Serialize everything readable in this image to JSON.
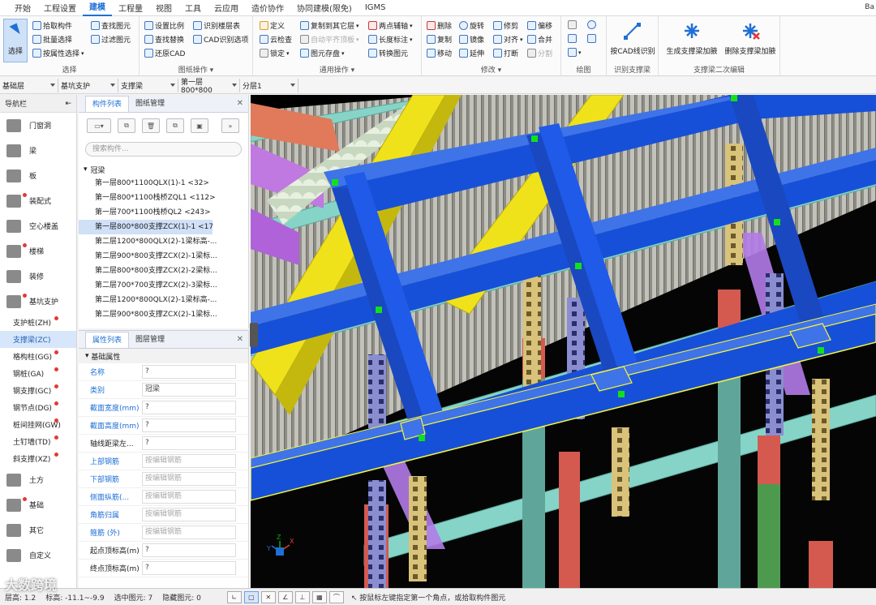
{
  "menu": {
    "items": [
      "开始",
      "工程设置",
      "建模",
      "工程量",
      "视图",
      "工具",
      "云应用",
      "造价协作",
      "协同建模(限免)",
      "IGMS"
    ],
    "active": "建模",
    "right_text": "Ba"
  },
  "ribbon": {
    "select_group": {
      "big_button": "选择",
      "pick": "拾取构件",
      "batch": "批量选择",
      "by_attr": "按属性选择",
      "find": "查找图元",
      "filter": "过滤图元",
      "label": "选择"
    },
    "drawing_group": {
      "scale": "设置比例",
      "find_replace": "查找替换",
      "restore_cad": "还原CAD",
      "identify_floor": "识别楼层表",
      "cad_options": "CAD识别选项",
      "label": "图纸操作"
    },
    "general_group": {
      "define": "定义",
      "cloud_check": "云检查",
      "lock": "锁定",
      "copy_floor": "复制到其它层",
      "auto_align": "自动平齐顶板",
      "save_element": "图元存盘",
      "two_point_axis": "两点辅轴",
      "length_mark": "长度标注",
      "convert": "转换图元",
      "label": "通用操作"
    },
    "modify_group": {
      "delete": "删除",
      "copy": "复制",
      "move": "移动",
      "rotate": "旋转",
      "mirror": "镜像",
      "extend": "延伸",
      "trim": "修剪",
      "align": "对齐",
      "break": "打断",
      "offset": "偏移",
      "merge": "合并",
      "split": "分割",
      "label": "修改"
    },
    "draw_group": {
      "label": "绘图"
    },
    "identify_group": {
      "button": "按CAD线识别",
      "label": "识别支撑梁"
    },
    "edit_group": {
      "generate": "生成支撑梁加腋",
      "remove": "删除支撑梁加腋",
      "label": "支撑梁二次编辑"
    }
  },
  "selectors": [
    "基础层",
    "基坑支护",
    "支撑梁",
    "第一层800*800",
    "分层1"
  ],
  "nav": {
    "title": "导航栏",
    "items": [
      {
        "label": "门窗洞",
        "dot": false
      },
      {
        "label": "梁",
        "dot": false
      },
      {
        "label": "板",
        "dot": false
      },
      {
        "label": "装配式",
        "dot": true
      },
      {
        "label": "空心楼盖",
        "dot": false
      },
      {
        "label": "楼梯",
        "dot": true
      },
      {
        "label": "装修",
        "dot": false
      },
      {
        "label": "基坑支护",
        "dot": true
      }
    ],
    "subitems": [
      {
        "label": "支护桩(ZH)",
        "dot": true,
        "selected": false
      },
      {
        "label": "支撑梁(ZC)",
        "dot": false,
        "selected": true
      },
      {
        "label": "格构柱(GG)",
        "dot": true,
        "selected": false
      },
      {
        "label": "钢桩(GA)",
        "dot": true,
        "selected": false
      },
      {
        "label": "钢支撑(GC)",
        "dot": true,
        "selected": false
      },
      {
        "label": "钢节点(DG)",
        "dot": true,
        "selected": false
      },
      {
        "label": "桩间挂网(GW)",
        "dot": true,
        "selected": false
      },
      {
        "label": "土钉墙(TD)",
        "dot": true,
        "selected": false
      },
      {
        "label": "斜支撑(XZ)",
        "dot": true,
        "selected": false
      }
    ],
    "bottom": [
      {
        "label": "土方",
        "dot": false
      },
      {
        "label": "基础",
        "dot": true
      },
      {
        "label": "其它",
        "dot": false
      },
      {
        "label": "自定义",
        "dot": false
      }
    ]
  },
  "components": {
    "tabs": [
      "构件列表",
      "图纸管理"
    ],
    "search_placeholder": "搜索构件...",
    "root": "冠梁",
    "rows": [
      "第一层800*1100QLX(1)-1 <32>",
      "第一层800*1100栈桥ZQL1 <112>",
      "第一层700*1100栈桥QL2 <243>",
      "第一层800*800支撑ZCX(1)-1 <17...",
      "第二层1200*800QLX(2)-1梁标高-...",
      "第二层900*800支撑ZCX(2)-1梁标...",
      "第二层800*800支撑ZCX(2)-2梁标...",
      "第二层700*700支撑ZCX(2)-3梁标...",
      "第二层1200*800QLX(2)-1梁标高-...",
      "第二层900*800支撑ZCX(2)-1梁标..."
    ],
    "selected_index": 3
  },
  "properties": {
    "tabs": [
      "属性列表",
      "图层管理"
    ],
    "group": "基础属性",
    "rows": [
      {
        "name": "名称",
        "value": "?",
        "placeholder": false,
        "blue": true
      },
      {
        "name": "类别",
        "value": "冠梁",
        "placeholder": false,
        "blue": true
      },
      {
        "name": "截面宽度(mm)",
        "value": "?",
        "placeholder": false,
        "blue": true
      },
      {
        "name": "截面高度(mm)",
        "value": "?",
        "placeholder": false,
        "blue": true
      },
      {
        "name": "轴线距梁左...",
        "value": "?",
        "placeholder": false,
        "blue": false
      },
      {
        "name": "上部钢筋",
        "value": "按编辑钢筋",
        "placeholder": true,
        "blue": true
      },
      {
        "name": "下部钢筋",
        "value": "按编辑钢筋",
        "placeholder": true,
        "blue": true
      },
      {
        "name": "侧面纵筋(...",
        "value": "按编辑钢筋",
        "placeholder": true,
        "blue": true
      },
      {
        "name": "角筋归属",
        "value": "按编辑钢筋",
        "placeholder": true,
        "blue": true
      },
      {
        "name": "箍筋 (外)",
        "value": "按编辑钢筋",
        "placeholder": true,
        "blue": true
      },
      {
        "name": "起点顶标高(m)",
        "value": "?",
        "placeholder": false,
        "blue": false
      },
      {
        "name": "终点顶标高(m)",
        "value": "?",
        "placeholder": false,
        "blue": false
      }
    ]
  },
  "status": {
    "floor_height_label": "层高:",
    "floor_height": "1.2",
    "elevation_label": "标高:",
    "elevation": "-11.1~-9.9",
    "selected_label": "选中图元:",
    "selected": "7",
    "hidden_label": "隐藏图元:",
    "hidden": "0",
    "hint": "按鼠标左键指定第一个角点，或拾取构件图元",
    "watermark": "大数跨境"
  },
  "colors": {
    "beam_blue": "#1750d8",
    "beam_yellow": "#f0e21a",
    "pile_gray": "#b0b0a8",
    "highlight": "#f5f53a",
    "marker": "#12e01a",
    "accent": "#1f6fd6"
  }
}
